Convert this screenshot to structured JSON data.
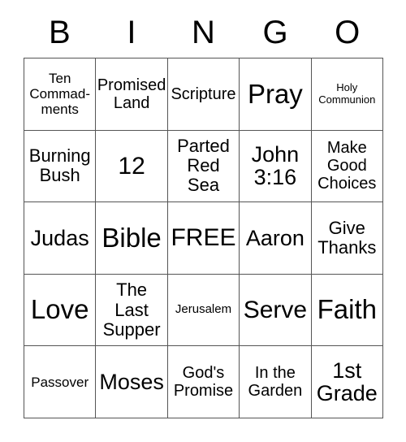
{
  "card": {
    "title": "BINGO",
    "header_letters": [
      "B",
      "I",
      "N",
      "G",
      "O"
    ],
    "grid_size": "5x5",
    "free_space_label": "FREE",
    "colors": {
      "text": "#000000",
      "background": "#ffffff",
      "border": "#555555"
    },
    "rows": [
      [
        {
          "label": "Ten\nCommad-\nments",
          "size": "s"
        },
        {
          "label": "Promised\nLand",
          "size": "m"
        },
        {
          "label": "Scripture",
          "size": "m"
        },
        {
          "label": "Pray",
          "size": "3xl"
        },
        {
          "label": "Holy\nCommunion",
          "size": "xxs"
        }
      ],
      [
        {
          "label": "Burning\nBush",
          "size": "ml"
        },
        {
          "label": "12",
          "size": "xxl"
        },
        {
          "label": "Parted\nRed\nSea",
          "size": "ml"
        },
        {
          "label": "John\n3:16",
          "size": "xl"
        },
        {
          "label": "Make\nGood\nChoices",
          "size": "m"
        }
      ],
      [
        {
          "label": "Judas",
          "size": "xl"
        },
        {
          "label": "Bible",
          "size": "3xl"
        },
        {
          "label": "FREE",
          "size": "xxl"
        },
        {
          "label": "Aaron",
          "size": "xl"
        },
        {
          "label": "Give\nThanks",
          "size": "ml"
        }
      ],
      [
        {
          "label": "Love",
          "size": "3xl"
        },
        {
          "label": "The\nLast\nSupper",
          "size": "ml"
        },
        {
          "label": "Jerusalem",
          "size": "xs"
        },
        {
          "label": "Serve",
          "size": "xxl"
        },
        {
          "label": "Faith",
          "size": "3xl"
        }
      ],
      [
        {
          "label": "Passover",
          "size": "s"
        },
        {
          "label": "Moses",
          "size": "xl"
        },
        {
          "label": "God's\nPromise",
          "size": "m"
        },
        {
          "label": "In the\nGarden",
          "size": "m"
        },
        {
          "label": "1st\nGrade",
          "size": "xl"
        }
      ]
    ]
  }
}
